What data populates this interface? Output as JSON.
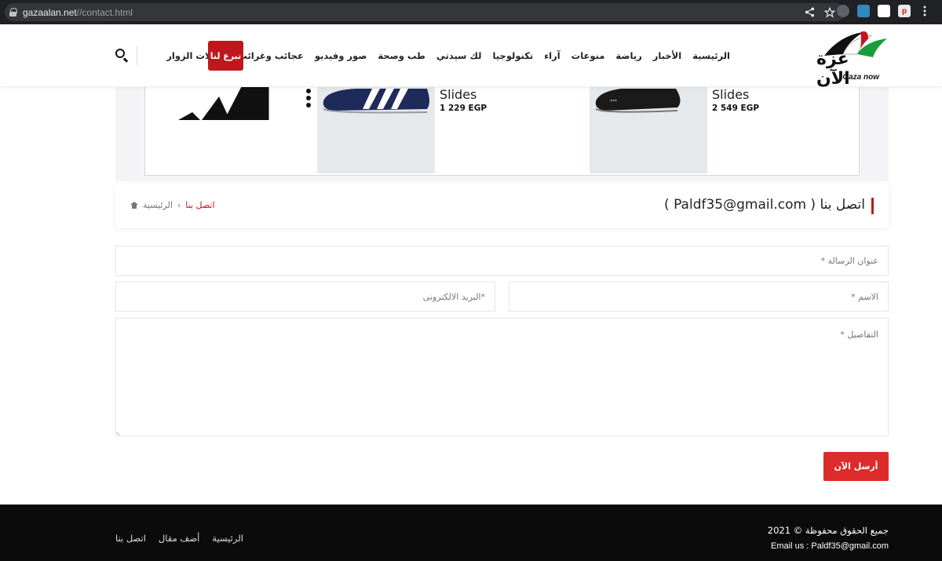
{
  "browser": {
    "url_host": "gazaalan.net",
    "url_path": "//contact.html"
  },
  "header": {
    "logo_ar": "غزة الآن",
    "logo_en": "Gaza now",
    "nav": [
      {
        "label": "الرئيسية"
      },
      {
        "label": "الأخبار"
      },
      {
        "label": "رياضة"
      },
      {
        "label": "منوعات"
      },
      {
        "label": "آراء"
      },
      {
        "label": "تكنولوجيا"
      },
      {
        "label": "لك سيدتي"
      },
      {
        "label": "طب وصحة"
      },
      {
        "label": "صور وفيديو"
      },
      {
        "label": "عجائب وغرائب"
      },
      {
        "label": "مقالات الزوار"
      }
    ],
    "donate_label": "تبرع لنا"
  },
  "ad": {
    "products": [
      {
        "name": "Slides",
        "price": "1 229 EGP"
      },
      {
        "name": "Slides",
        "price": "2 549 EGP"
      }
    ]
  },
  "page": {
    "title": "اتصل بنا ( Paldf35@gmail.com )",
    "breadcrumb_home": "الرئيسية",
    "breadcrumb_current": "اتصل بنا"
  },
  "form": {
    "subject_placeholder": "عنوان الرسالة *",
    "name_placeholder": "الاسم *",
    "email_placeholder": "*البريد الالكترونى",
    "details_placeholder": "التفاصيل *",
    "send_label": "أرسل الآن"
  },
  "footer": {
    "copyright": "جميع الحقوق محفوظة © 2021",
    "email": "Email us : Paldf35@gmail.com",
    "links": [
      {
        "label": "الرئيسية"
      },
      {
        "label": "أضف مقال"
      },
      {
        "label": "اتصل بنا"
      }
    ]
  },
  "colors": {
    "accent": "#c0161e",
    "send_button": "#dc2b2b",
    "footer_bg": "#0b0b0b"
  }
}
